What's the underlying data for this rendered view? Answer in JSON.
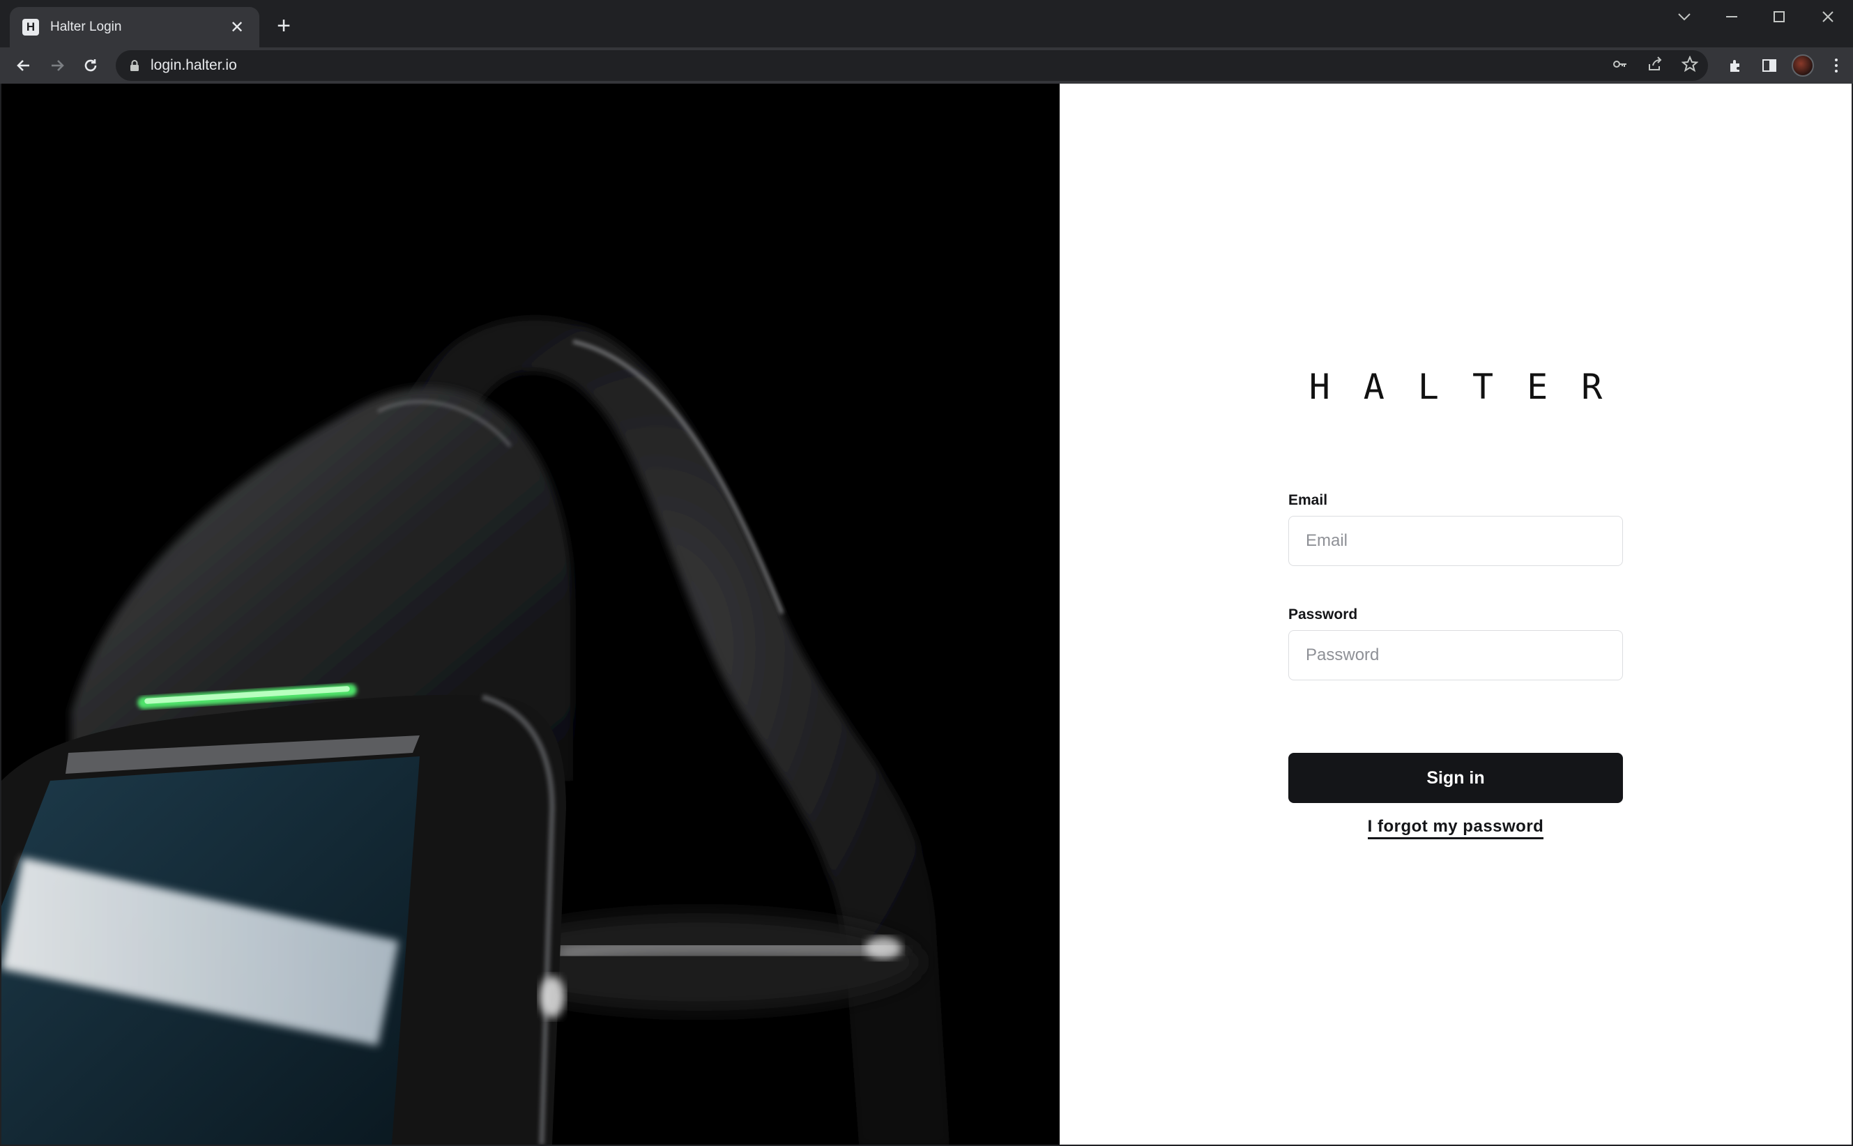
{
  "browser": {
    "tab": {
      "favicon_letter": "H",
      "title": "Halter Login",
      "close_glyph": "✕"
    },
    "new_tab_glyph": "+",
    "url": "login.halter.io",
    "icons": [
      "back-icon",
      "forward-icon",
      "reload-icon",
      "lock-icon",
      "key-icon",
      "share-icon",
      "star-icon",
      "extensions-icon",
      "side-panel-icon",
      "avatar",
      "menu-icon",
      "tab-search-icon",
      "minimize-icon",
      "maximize-icon",
      "close-window-icon"
    ]
  },
  "page": {
    "brand": "HALTER",
    "email": {
      "label": "Email",
      "placeholder": "Email",
      "value": ""
    },
    "password": {
      "label": "Password",
      "placeholder": "Password",
      "value": ""
    },
    "signin_label": "Sign in",
    "forgot_label": "I forgot my password",
    "colors": {
      "button_bg": "#141518",
      "text": "#141518",
      "led_green": "#4fe36a",
      "hero_bg": "#000000"
    }
  }
}
